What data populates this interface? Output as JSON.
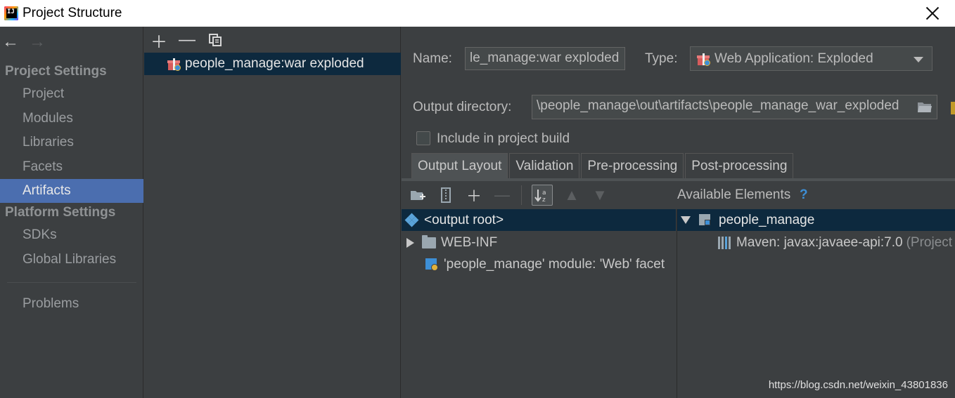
{
  "window": {
    "title": "Project Structure"
  },
  "nav": {
    "project_settings_header": "Project Settings",
    "platform_settings_header": "Platform Settings",
    "items": {
      "project": "Project",
      "modules": "Modules",
      "libraries": "Libraries",
      "facets": "Facets",
      "artifacts": "Artifacts",
      "sdks": "SDKs",
      "global_libraries": "Global Libraries",
      "problems": "Problems"
    },
    "active": "Artifacts"
  },
  "artifacts": {
    "list": [
      {
        "label": "people_manage:war exploded"
      }
    ]
  },
  "detail": {
    "name_label": "Name:",
    "name_value": "le_manage:war exploded",
    "type_label": "Type:",
    "type_value": "Web Application: Exploded",
    "output_dir_label": "Output directory:",
    "output_dir_value": "\\people_manage\\out\\artifacts\\people_manage_war_exploded",
    "include_build_label": "Include in project build",
    "include_build_checked": false,
    "tabs": [
      "Output Layout",
      "Validation",
      "Pre-processing",
      "Post-processing"
    ],
    "active_tab": "Output Layout",
    "available_elements_label": "Available Elements",
    "help_glyph": "?",
    "output_tree": {
      "root": "<output root>",
      "children": [
        {
          "label": "WEB-INF",
          "icon": "folder-icon"
        },
        {
          "label": "'people_manage' module: 'Web' facet",
          "icon": "web-facet-icon"
        }
      ]
    },
    "available_tree": {
      "root": "people_manage",
      "children": [
        {
          "label": "Maven: javax:javaee-api:7.0",
          "suffix": "(Project"
        }
      ]
    }
  },
  "watermark": "https://blog.csdn.net/weixin_43801836",
  "colors": {
    "selection": "#0d293e",
    "nav_active": "#4b6eaf",
    "background": "#3c3f41",
    "help": "#3d8fd6"
  }
}
